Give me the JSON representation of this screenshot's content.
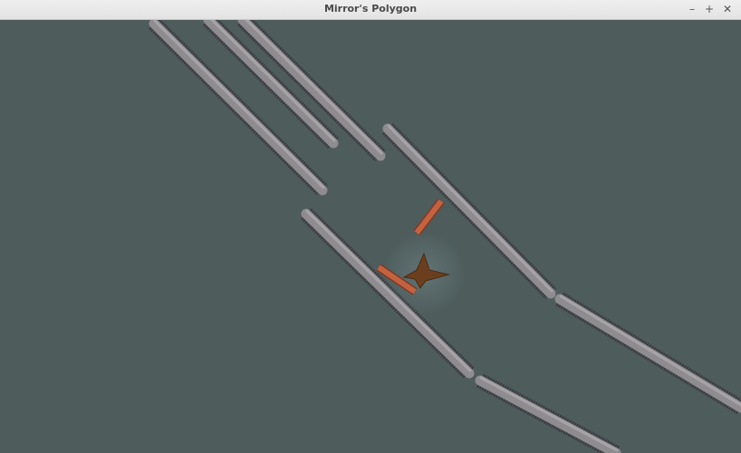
{
  "window": {
    "title": "Mirror's Polygon",
    "minimize_icon": "minimize-icon",
    "maximize_icon": "maximize-icon",
    "close_icon": "close-icon",
    "minimize_glyph": "–",
    "maximize_glyph": "+",
    "close_glyph": "✕"
  },
  "scene": {
    "background_color": "#4e5c5c",
    "wall_fill": "#8f8c90",
    "wall_border": "#3b3b3f",
    "mirror_color": "#c4623f",
    "player_color": "#6b3f1e"
  }
}
